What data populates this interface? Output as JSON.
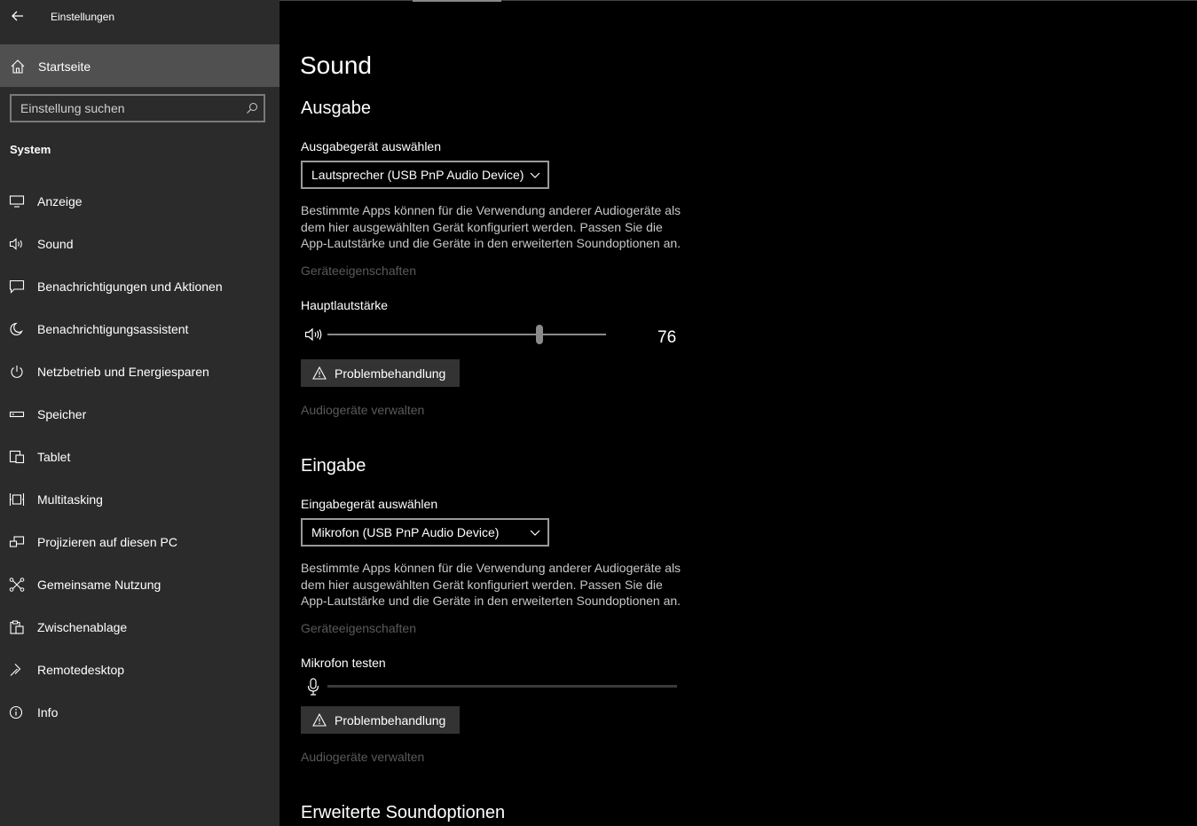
{
  "window": {
    "title": "Einstellungen"
  },
  "sidebar": {
    "home_label": "Startseite",
    "search": {
      "placeholder": "Einstellung suchen"
    },
    "section": "System",
    "items": [
      {
        "label": "Anzeige",
        "icon": "monitor-icon"
      },
      {
        "label": "Sound",
        "icon": "speaker-icon"
      },
      {
        "label": "Benachrichtigungen und Aktionen",
        "icon": "notification-icon"
      },
      {
        "label": "Benachrichtigungsassistent",
        "icon": "moon-icon"
      },
      {
        "label": "Netzbetrieb und Energiesparen",
        "icon": "power-icon"
      },
      {
        "label": "Speicher",
        "icon": "storage-icon"
      },
      {
        "label": "Tablet",
        "icon": "tablet-icon"
      },
      {
        "label": "Multitasking",
        "icon": "multitasking-icon"
      },
      {
        "label": "Projizieren auf diesen PC",
        "icon": "project-icon"
      },
      {
        "label": "Gemeinsame Nutzung",
        "icon": "share-icon"
      },
      {
        "label": "Zwischenablage",
        "icon": "clipboard-icon"
      },
      {
        "label": "Remotedesktop",
        "icon": "remote-icon"
      },
      {
        "label": "Info",
        "icon": "info-icon"
      }
    ]
  },
  "main": {
    "title": "Sound",
    "output": {
      "heading": "Ausgabe",
      "device_label": "Ausgabegerät auswählen",
      "device_value": "Lautsprecher (USB PnP Audio Device)",
      "description": "Bestimmte Apps können für die Verwendung anderer Audiogeräte als dem hier ausgewählten Gerät konfiguriert werden. Passen Sie die App-Lautstärke und die Geräte in den erweiterten Soundoptionen an.",
      "properties_link": "Geräteeigenschaften",
      "volume_label": "Hauptlautstärke",
      "volume_value": "76",
      "volume_level": 76,
      "troubleshoot_label": "Problembehandlung",
      "manage_link": "Audiogeräte verwalten"
    },
    "input": {
      "heading": "Eingabe",
      "device_label": "Eingabegerät auswählen",
      "device_value": "Mikrofon (USB PnP Audio Device)",
      "description": "Bestimmte Apps können für die Verwendung anderer Audiogeräte als dem hier ausgewählten Gerät konfiguriert werden. Passen Sie die App-Lautstärke und die Geräte in den erweiterten Soundoptionen an.",
      "properties_link": "Geräteeigenschaften",
      "test_label": "Mikrofon testen",
      "mic_level": 0,
      "troubleshoot_label": "Problembehandlung",
      "manage_link": "Audiogeräte verwalten"
    },
    "advanced_heading": "Erweiterte Soundoptionen"
  },
  "colors": {
    "sidebar_bg": "#2b2b2b",
    "selected_bg": "#505050",
    "main_bg": "#000000",
    "disabled_text": "#5a5a5a",
    "button_bg": "#333333"
  }
}
